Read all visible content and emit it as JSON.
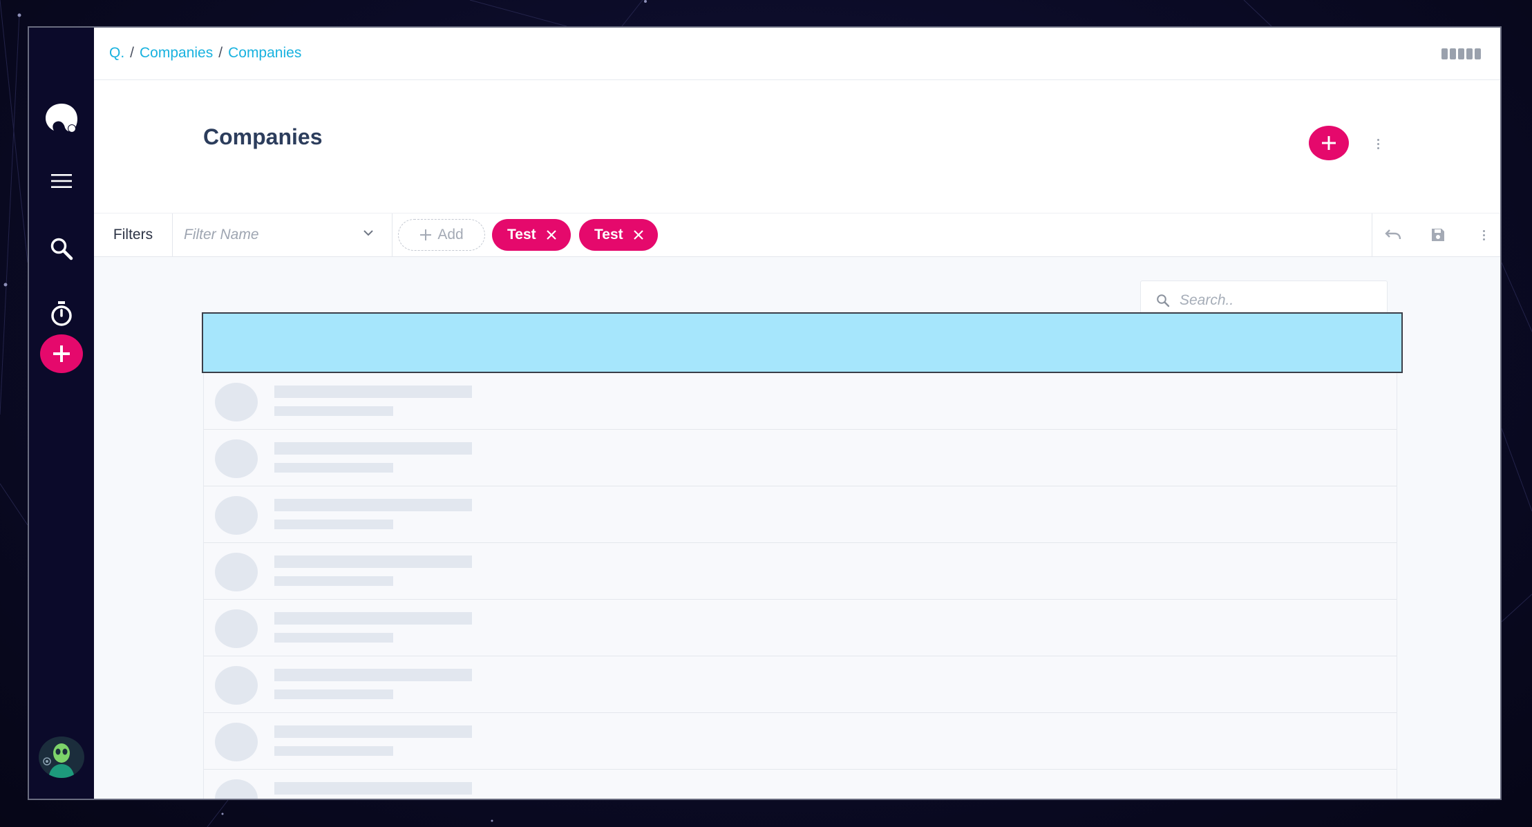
{
  "breadcrumb": {
    "root": "Q.",
    "separator": "/",
    "items": [
      "Companies",
      "Companies"
    ]
  },
  "header": {
    "title": "Companies"
  },
  "filter_bar": {
    "label": "Filters",
    "filter_name_placeholder": "Filter Name",
    "add_label": "Add",
    "chips": [
      {
        "label": "Test"
      },
      {
        "label": "Test"
      }
    ]
  },
  "search": {
    "placeholder": "Search.."
  },
  "colors": {
    "accent": "#e5096c",
    "link": "#18b2df",
    "sidebar": "#0b0a2a",
    "list_header": "#a6e6fc",
    "skeleton": "#e2e7ef"
  },
  "sidebar": {
    "items": [
      {
        "icon": "app-logo-icon"
      },
      {
        "icon": "menu-icon"
      },
      {
        "icon": "search-icon"
      },
      {
        "icon": "stopwatch-icon"
      },
      {
        "icon": "plus-icon"
      },
      {
        "icon": "alien-avatar-icon"
      }
    ]
  },
  "list": {
    "loading": true,
    "skeleton_row_count": 8
  }
}
